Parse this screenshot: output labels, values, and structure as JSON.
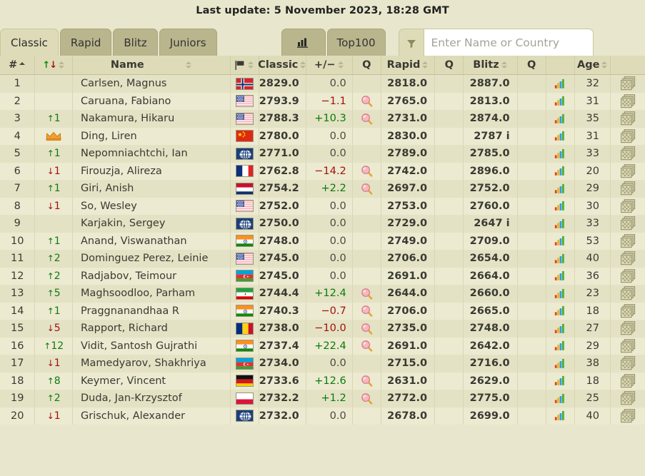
{
  "header": {
    "last_update": "Last update: 5 November 2023, 18:28 GMT"
  },
  "tabs": [
    {
      "label": "Classic",
      "active": true
    },
    {
      "label": "Rapid",
      "active": false
    },
    {
      "label": "Blitz",
      "active": false
    },
    {
      "label": "Juniors",
      "active": false
    }
  ],
  "toolbar": {
    "chart_button_icon": "bar-chart-icon",
    "top100_label": "Top100",
    "filter_icon": "funnel-icon",
    "search_placeholder": "Enter Name or Country",
    "search_value": ""
  },
  "columns": [
    {
      "key": "rank",
      "label": "#",
      "sort": "asc"
    },
    {
      "key": "move",
      "label": "",
      "sort": "updown"
    },
    {
      "key": "name",
      "label": "Name",
      "sort": "both"
    },
    {
      "key": "flag",
      "label": "",
      "sort": "both"
    },
    {
      "key": "classic",
      "label": "Classic",
      "sort": "both"
    },
    {
      "key": "change",
      "label": "+/−",
      "sort": "both"
    },
    {
      "key": "q1",
      "label": "Q",
      "sort": "both"
    },
    {
      "key": "rapid",
      "label": "Rapid",
      "sort": "both"
    },
    {
      "key": "q2",
      "label": "Q",
      "sort": "both"
    },
    {
      "key": "blitz",
      "label": "Blitz",
      "sort": "both"
    },
    {
      "key": "q3",
      "label": "Q",
      "sort": "both"
    },
    {
      "key": "chart",
      "label": "",
      "sort": "none"
    },
    {
      "key": "age",
      "label": "Age",
      "sort": "both"
    },
    {
      "key": "copy",
      "label": "",
      "sort": "none"
    }
  ],
  "colors": {
    "page_bg": "#e8e7cd",
    "header_bg": "#dedcb8",
    "tab_inactive": "#b9b68d",
    "tab_active": "#dedcb8",
    "row_odd": "#e4e2c4",
    "row_even": "#ecead0",
    "classic_value": "#2b2b26",
    "rapid_value": "#97110f",
    "blitz_value": "#1b6aa5",
    "gain": "#0a7a0a",
    "loss": "#a01010"
  },
  "rows": [
    {
      "rank": "1",
      "move": "",
      "move_dir": "none",
      "title": "crown-none",
      "name": "Carlsen, Magnus",
      "flag": "NOR",
      "classic": "2829.0",
      "change": "0.0",
      "change_dir": "zero",
      "has_mag": false,
      "rapid": "2818.0",
      "blitz": "2887.0",
      "age": "32"
    },
    {
      "rank": "2",
      "move": "",
      "move_dir": "none",
      "title": "",
      "name": "Caruana, Fabiano",
      "flag": "USA",
      "classic": "2793.9",
      "change": "−1.1",
      "change_dir": "neg",
      "has_mag": true,
      "rapid": "2765.0",
      "blitz": "2813.0",
      "age": "31"
    },
    {
      "rank": "3",
      "move": "1",
      "move_dir": "up",
      "title": "",
      "name": "Nakamura, Hikaru",
      "flag": "USA",
      "classic": "2788.3",
      "change": "+10.3",
      "change_dir": "pos",
      "has_mag": true,
      "rapid": "2731.0",
      "blitz": "2874.0",
      "age": "35"
    },
    {
      "rank": "4",
      "move": "",
      "move_dir": "crown",
      "title": "world-champion",
      "name": "Ding, Liren",
      "flag": "CHN",
      "classic": "2780.0",
      "change": "0.0",
      "change_dir": "zero",
      "has_mag": false,
      "rapid": "2830.0",
      "blitz": "2787 i",
      "age": "31"
    },
    {
      "rank": "5",
      "move": "1",
      "move_dir": "up",
      "title": "",
      "name": "Nepomniachtchi, Ian",
      "flag": "FID",
      "classic": "2771.0",
      "change": "0.0",
      "change_dir": "zero",
      "has_mag": false,
      "rapid": "2789.0",
      "blitz": "2785.0",
      "age": "33"
    },
    {
      "rank": "6",
      "move": "1",
      "move_dir": "down",
      "title": "",
      "name": "Firouzja, Alireza",
      "flag": "FRA",
      "classic": "2762.8",
      "change": "−14.2",
      "change_dir": "neg",
      "has_mag": true,
      "rapid": "2742.0",
      "blitz": "2896.0",
      "age": "20"
    },
    {
      "rank": "7",
      "move": "1",
      "move_dir": "up",
      "title": "",
      "name": "Giri, Anish",
      "flag": "NED",
      "classic": "2754.2",
      "change": "+2.2",
      "change_dir": "pos",
      "has_mag": true,
      "rapid": "2697.0",
      "blitz": "2752.0",
      "age": "29"
    },
    {
      "rank": "8",
      "move": "1",
      "move_dir": "down",
      "title": "",
      "name": "So, Wesley",
      "flag": "USA",
      "classic": "2752.0",
      "change": "0.0",
      "change_dir": "zero",
      "has_mag": false,
      "rapid": "2753.0",
      "blitz": "2760.0",
      "age": "30"
    },
    {
      "rank": "9",
      "move": "",
      "move_dir": "none",
      "title": "",
      "name": "Karjakin, Sergey",
      "flag": "FID",
      "classic": "2750.0",
      "change": "0.0",
      "change_dir": "zero",
      "has_mag": false,
      "rapid": "2729.0",
      "blitz": "2647 i",
      "age": "33"
    },
    {
      "rank": "10",
      "move": "1",
      "move_dir": "up",
      "title": "",
      "name": "Anand, Viswanathan",
      "flag": "IND",
      "classic": "2748.0",
      "change": "0.0",
      "change_dir": "zero",
      "has_mag": false,
      "rapid": "2749.0",
      "blitz": "2709.0",
      "age": "53"
    },
    {
      "rank": "11",
      "move": "2",
      "move_dir": "up",
      "title": "",
      "name": "Dominguez Perez, Leinie",
      "flag": "USA",
      "classic": "2745.0",
      "change": "0.0",
      "change_dir": "zero",
      "has_mag": false,
      "rapid": "2706.0",
      "blitz": "2654.0",
      "age": "40"
    },
    {
      "rank": "12",
      "move": "2",
      "move_dir": "up",
      "title": "",
      "name": "Radjabov, Teimour",
      "flag": "AZE",
      "classic": "2745.0",
      "change": "0.0",
      "change_dir": "zero",
      "has_mag": false,
      "rapid": "2691.0",
      "blitz": "2664.0",
      "age": "36"
    },
    {
      "rank": "13",
      "move": "5",
      "move_dir": "up",
      "title": "",
      "name": "Maghsoodloo, Parham",
      "flag": "IRI",
      "classic": "2744.4",
      "change": "+12.4",
      "change_dir": "pos",
      "has_mag": true,
      "rapid": "2644.0",
      "blitz": "2660.0",
      "age": "23"
    },
    {
      "rank": "14",
      "move": "1",
      "move_dir": "up",
      "title": "",
      "name": "Praggnanandhaa R",
      "flag": "IND",
      "classic": "2740.3",
      "change": "−0.7",
      "change_dir": "neg",
      "has_mag": true,
      "rapid": "2706.0",
      "blitz": "2665.0",
      "age": "18"
    },
    {
      "rank": "15",
      "move": "5",
      "move_dir": "down",
      "title": "",
      "name": "Rapport, Richard",
      "flag": "ROU",
      "classic": "2738.0",
      "change": "−10.0",
      "change_dir": "neg",
      "has_mag": true,
      "rapid": "2735.0",
      "blitz": "2748.0",
      "age": "27"
    },
    {
      "rank": "16",
      "move": "12",
      "move_dir": "up",
      "title": "",
      "name": "Vidit, Santosh Gujrathi",
      "flag": "IND",
      "classic": "2737.4",
      "change": "+22.4",
      "change_dir": "pos",
      "has_mag": true,
      "rapid": "2691.0",
      "blitz": "2642.0",
      "age": "29"
    },
    {
      "rank": "17",
      "move": "1",
      "move_dir": "down",
      "title": "",
      "name": "Mamedyarov, Shakhriya",
      "flag": "AZE",
      "classic": "2734.0",
      "change": "0.0",
      "change_dir": "zero",
      "has_mag": false,
      "rapid": "2715.0",
      "blitz": "2716.0",
      "age": "38"
    },
    {
      "rank": "18",
      "move": "8",
      "move_dir": "up",
      "title": "",
      "name": "Keymer, Vincent",
      "flag": "GER",
      "classic": "2733.6",
      "change": "+12.6",
      "change_dir": "pos",
      "has_mag": true,
      "rapid": "2631.0",
      "blitz": "2629.0",
      "age": "18"
    },
    {
      "rank": "19",
      "move": "2",
      "move_dir": "up",
      "title": "",
      "name": "Duda, Jan-Krzysztof",
      "flag": "POL",
      "classic": "2732.2",
      "change": "+1.2",
      "change_dir": "pos",
      "has_mag": true,
      "rapid": "2772.0",
      "blitz": "2775.0",
      "age": "25"
    },
    {
      "rank": "20",
      "move": "1",
      "move_dir": "down",
      "title": "",
      "name": "Grischuk, Alexander",
      "flag": "FID",
      "classic": "2732.0",
      "change": "0.0",
      "change_dir": "zero",
      "has_mag": false,
      "rapid": "2678.0",
      "blitz": "2699.0",
      "age": "40"
    }
  ]
}
